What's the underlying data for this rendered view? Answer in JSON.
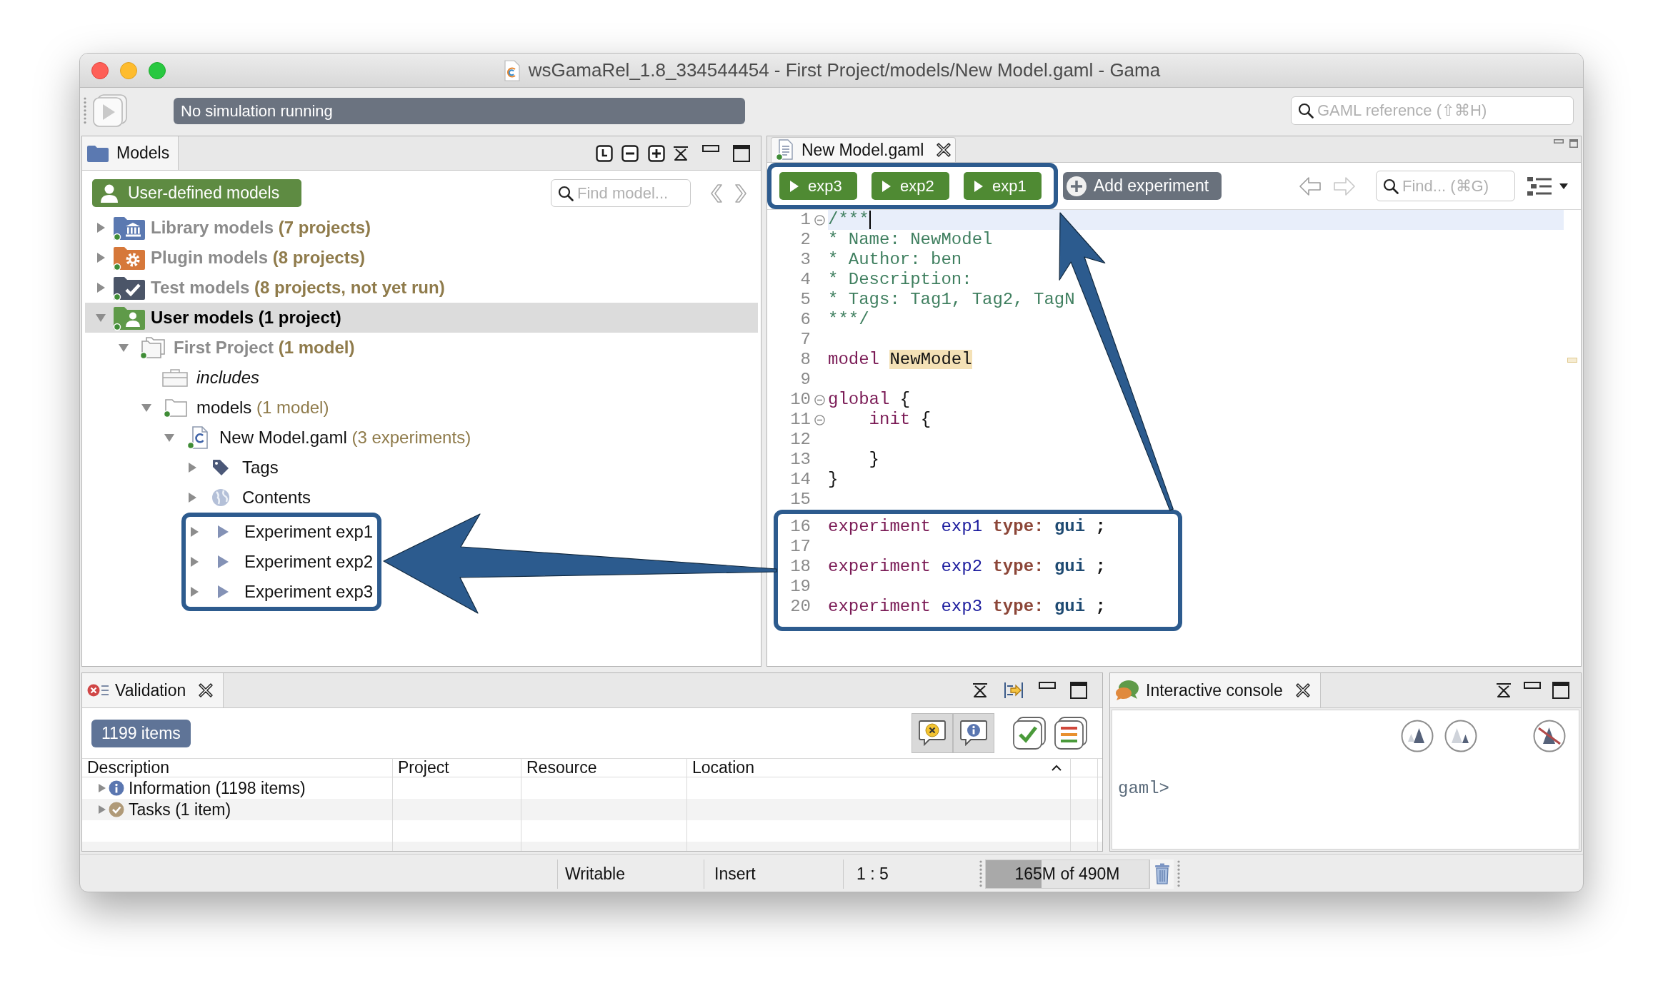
{
  "window": {
    "title": "wsGamaRel_1.8_334544454 - First Project/models/New Model.gaml - Gama"
  },
  "toolbar": {
    "simulation_status": "No simulation running",
    "search": {
      "placeholder": "GAML reference (⇧⌘H)"
    }
  },
  "models_view": {
    "tab_label": "Models",
    "scope_button": "User-defined models",
    "search": {
      "placeholder": "Find model..."
    },
    "tree": [
      {
        "label": "Library models",
        "detail": "(7 projects)",
        "kind": "library",
        "expanded": false,
        "selected": false
      },
      {
        "label": "Plugin models",
        "detail": "(8 projects)",
        "kind": "plugin",
        "expanded": false,
        "selected": false
      },
      {
        "label": "Test models",
        "detail": "(8 projects, not yet run)",
        "kind": "test",
        "expanded": false,
        "selected": false
      },
      {
        "label": "User models",
        "detail": "(1 project)",
        "kind": "user",
        "expanded": true,
        "selected": true,
        "children": [
          {
            "label": "First Project",
            "detail": "(1 model)",
            "kind": "project",
            "expanded": true,
            "selected": false,
            "children": [
              {
                "label": "includes",
                "kind": "includes",
                "selected": false
              },
              {
                "label": "models",
                "detail": "(1 model)",
                "kind": "folder",
                "expanded": true,
                "selected": false,
                "children": [
                  {
                    "label": "New Model.gaml",
                    "detail": "(3 experiments)",
                    "kind": "model_file",
                    "expanded": true,
                    "selected": false,
                    "children": [
                      {
                        "label": "Tags",
                        "kind": "tags",
                        "expanded": false,
                        "selected": false,
                        "highlighted": false
                      },
                      {
                        "label": "Contents",
                        "kind": "contents",
                        "expanded": false,
                        "selected": false,
                        "highlighted": false
                      },
                      {
                        "label": "Experiment exp1",
                        "kind": "experiment",
                        "expanded": false,
                        "selected": false,
                        "highlighted": true
                      },
                      {
                        "label": "Experiment exp2",
                        "kind": "experiment",
                        "expanded": false,
                        "selected": false,
                        "highlighted": true
                      },
                      {
                        "label": "Experiment exp3",
                        "kind": "experiment",
                        "expanded": false,
                        "selected": false,
                        "highlighted": true
                      }
                    ]
                  }
                ]
              }
            ]
          }
        ]
      }
    ]
  },
  "editor": {
    "tab_label": "New Model.gaml",
    "experiment_buttons": {
      "highlighted": true,
      "items": [
        {
          "label": "exp3"
        },
        {
          "label": "exp2"
        },
        {
          "label": "exp1"
        }
      ]
    },
    "add_button": "Add experiment",
    "search": {
      "placeholder": "Find... (⌘G)"
    },
    "sections": [
      {
        "highlighted": false,
        "lines": [
          {
            "number": "1",
            "current": true,
            "foldable": true,
            "tokens": [
              {
                "text": "/***",
                "kind": "comment"
              }
            ]
          },
          {
            "number": "2",
            "current": false,
            "foldable": false,
            "tokens": [
              {
                "text": "* Name: NewModel",
                "kind": "comment"
              }
            ]
          },
          {
            "number": "3",
            "current": false,
            "foldable": false,
            "tokens": [
              {
                "text": "* Author: ben",
                "kind": "comment"
              }
            ]
          },
          {
            "number": "4",
            "current": false,
            "foldable": false,
            "tokens": [
              {
                "text": "* Description:",
                "kind": "comment"
              }
            ]
          },
          {
            "number": "5",
            "current": false,
            "foldable": false,
            "tokens": [
              {
                "text": "* Tags: Tag1, Tag2, TagN",
                "kind": "comment"
              }
            ]
          },
          {
            "number": "6",
            "current": false,
            "foldable": false,
            "tokens": [
              {
                "text": "***/",
                "kind": "comment"
              }
            ]
          },
          {
            "number": "7",
            "current": false,
            "foldable": false
          },
          {
            "number": "8",
            "current": false,
            "foldable": false,
            "tokens": [
              {
                "text": "model ",
                "kind": "keyword"
              },
              {
                "text": "NewModel",
                "kind": "occurrence"
              }
            ]
          },
          {
            "number": "9",
            "current": false,
            "foldable": false
          },
          {
            "number": "10",
            "current": false,
            "foldable": true,
            "tokens": [
              {
                "text": "global ",
                "kind": "keyword"
              },
              {
                "text": "{",
                "kind": "plain"
              }
            ]
          },
          {
            "number": "11",
            "current": false,
            "foldable": true,
            "tokens": [
              {
                "text": "    init ",
                "kind": "keyword"
              },
              {
                "text": "{",
                "kind": "plain"
              }
            ]
          },
          {
            "number": "12",
            "current": false,
            "foldable": false
          },
          {
            "number": "13",
            "current": false,
            "foldable": false,
            "tokens": [
              {
                "text": "    }",
                "kind": "plain"
              }
            ]
          },
          {
            "number": "14",
            "current": false,
            "foldable": false,
            "tokens": [
              {
                "text": "}",
                "kind": "plain"
              }
            ]
          },
          {
            "number": "15",
            "current": false,
            "foldable": false
          }
        ]
      },
      {
        "highlighted": true,
        "lines": [
          {
            "number": "16",
            "current": false,
            "foldable": false,
            "tokens": [
              {
                "text": "experiment ",
                "kind": "keyword"
              },
              {
                "text": "exp1 ",
                "kind": "identifier"
              },
              {
                "text": "type: ",
                "kind": "facet"
              },
              {
                "text": "gui ",
                "kind": "value"
              },
              {
                "text": ";",
                "kind": "punct"
              }
            ]
          },
          {
            "number": "17",
            "current": false,
            "foldable": false
          },
          {
            "number": "18",
            "current": false,
            "foldable": false,
            "tokens": [
              {
                "text": "experiment ",
                "kind": "keyword"
              },
              {
                "text": "exp2 ",
                "kind": "identifier"
              },
              {
                "text": "type: ",
                "kind": "facet"
              },
              {
                "text": "gui ",
                "kind": "value"
              },
              {
                "text": ";",
                "kind": "punct"
              }
            ]
          },
          {
            "number": "19",
            "current": false,
            "foldable": false
          },
          {
            "number": "20",
            "current": false,
            "foldable": false,
            "tokens": [
              {
                "text": "experiment ",
                "kind": "keyword"
              },
              {
                "text": "exp3 ",
                "kind": "identifier"
              },
              {
                "text": "type: ",
                "kind": "facet"
              },
              {
                "text": "gui ",
                "kind": "value"
              },
              {
                "text": ";",
                "kind": "punct"
              }
            ]
          }
        ]
      }
    ]
  },
  "validation_view": {
    "tab_label": "Validation",
    "count_badge": "1199 items",
    "filters": [
      {
        "kind": "warnings",
        "selected": true
      },
      {
        "kind": "infos",
        "selected": true
      }
    ],
    "table": {
      "columns": [
        {
          "label": "Description",
          "sorted": false
        },
        {
          "label": "Project",
          "sorted": false
        },
        {
          "label": "Resource",
          "sorted": false
        },
        {
          "label": "Location",
          "sorted": true
        }
      ],
      "rows": [
        {
          "label": "Information (1198 items)",
          "kind": "info",
          "expanded": false
        },
        {
          "label": "Tasks (1 item)",
          "kind": "tasks",
          "expanded": false
        }
      ]
    }
  },
  "console_view": {
    "tab_label": "Interactive console",
    "prompt": "gaml>"
  },
  "status_bar": {
    "write_mode": "Writable",
    "insert_mode": "Insert",
    "cursor_position": "1 : 5",
    "memory": {
      "reading": "165M of 490M",
      "level": 0.34
    }
  }
}
